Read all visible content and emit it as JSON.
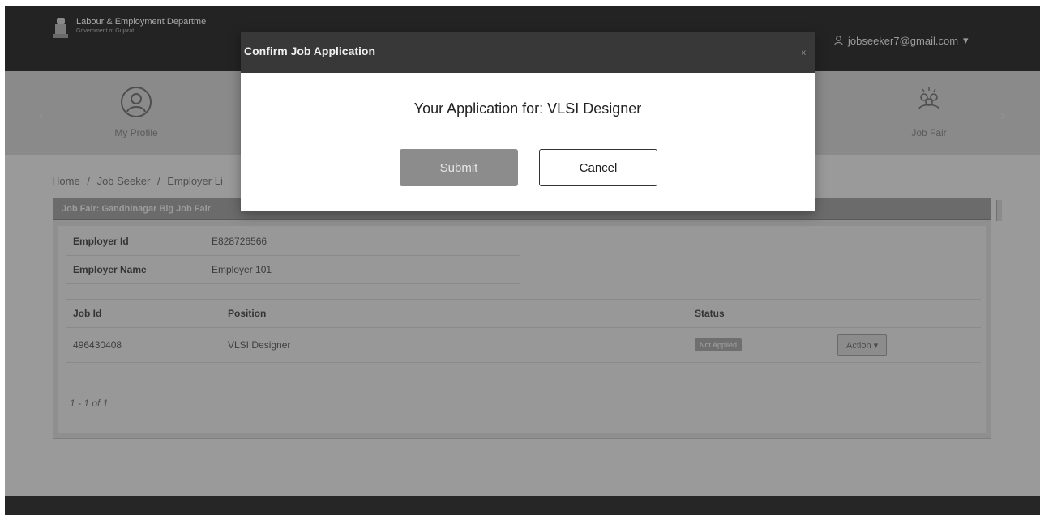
{
  "header": {
    "org_name": "Labour & Employment Departme",
    "org_sub": "Government of Gujarat",
    "user_email": "jobseeker7@gmail.com",
    "user_icon": "person-icon",
    "user_caret": "▾"
  },
  "tiles": {
    "profile_label": "My Profile",
    "jobfair_label": "Job Fair",
    "left_arrow": "‹",
    "right_arrow": "›"
  },
  "breadcrumb": {
    "home": "Home",
    "job_seeker": "Job Seeker",
    "employer_list": "Employer Li",
    "sep": "/"
  },
  "panel": {
    "heading": "Job Fair: Gandhinagar Big Job Fair"
  },
  "employer": {
    "id_label": "Employer Id",
    "id_value": "E828726566",
    "name_label": "Employer Name",
    "name_value": "Employer 101"
  },
  "jobs": {
    "headers": [
      "Job Id",
      "Position",
      "Status",
      ""
    ],
    "rows": [
      {
        "job_id": "496430408",
        "position": "VLSI Designer",
        "status": "Not Applied",
        "action": "Action"
      }
    ],
    "pager": "1 - 1 of 1"
  },
  "modal": {
    "title": "Confirm Job Application",
    "close": "x",
    "message": "Your Application for: VLSI Designer",
    "submit_label": "Submit",
    "cancel_label": "Cancel"
  },
  "colors": {
    "navbar": "#232323",
    "modal_header": "#383838",
    "overlay_bg": "#9a9a9a"
  }
}
